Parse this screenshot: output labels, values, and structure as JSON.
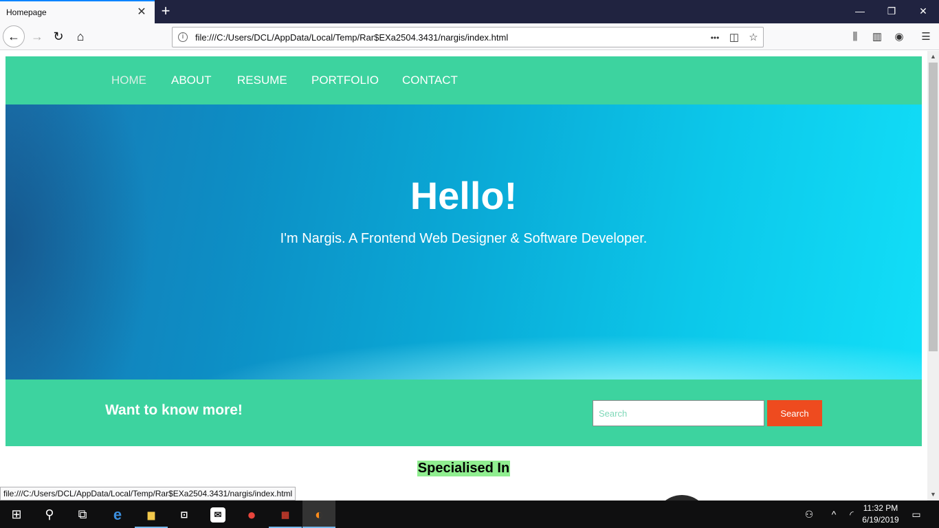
{
  "browser": {
    "tab_title": "Homepage",
    "tab_close": "✕",
    "new_tab": "+",
    "window_controls": {
      "minimize": "—",
      "restore": "❐",
      "close": "✕"
    },
    "url": "file:///C:/Users/DCL/AppData/Local/Temp/Rar$EXa2504.3431/nargis/index.html",
    "icons": {
      "back": "←",
      "forward": "→",
      "reload": "↻",
      "home": "⌂",
      "info": "i",
      "more": "•••",
      "pocket": "◫",
      "bookmark": "☆",
      "library": "⫼",
      "sidebar": "▥",
      "account": "◉",
      "menu": "☰"
    },
    "status_url": "file:///C:/Users/DCL/AppData/Local/Temp/Rar$EXa2504.3431/nargis/index.html"
  },
  "site": {
    "nav": [
      "HOME",
      "ABOUT",
      "RESUME",
      "PORTFOLIO",
      "CONTACT"
    ],
    "hero": {
      "title": "Hello!",
      "subtitle": "I'm Nargis. A Frontend Web Designer & Software Developer."
    },
    "cta": {
      "heading": "Want to know more!",
      "search_placeholder": "Search",
      "search_button": "Search"
    },
    "section_heading": "Specialised In"
  },
  "scrollbar": {
    "up": "▲",
    "down": "▼"
  },
  "taskbar": {
    "start": "⊞",
    "search": "⚲",
    "task_view": "⧉",
    "apps": {
      "edge": "e",
      "explorer": "▆",
      "store": "⊡",
      "mail": "✉",
      "chrome": "●",
      "winrar": "▦",
      "firefox": "◐"
    },
    "tray": {
      "people": "⚇",
      "chevron": "^",
      "wifi": "◜",
      "notifications": "▭"
    },
    "time": "11:32 PM",
    "date": "6/19/2019"
  },
  "colors": {
    "accent_green": "#3dd39f",
    "search_button": "#ee4b1f",
    "highlight": "#90ee90"
  }
}
